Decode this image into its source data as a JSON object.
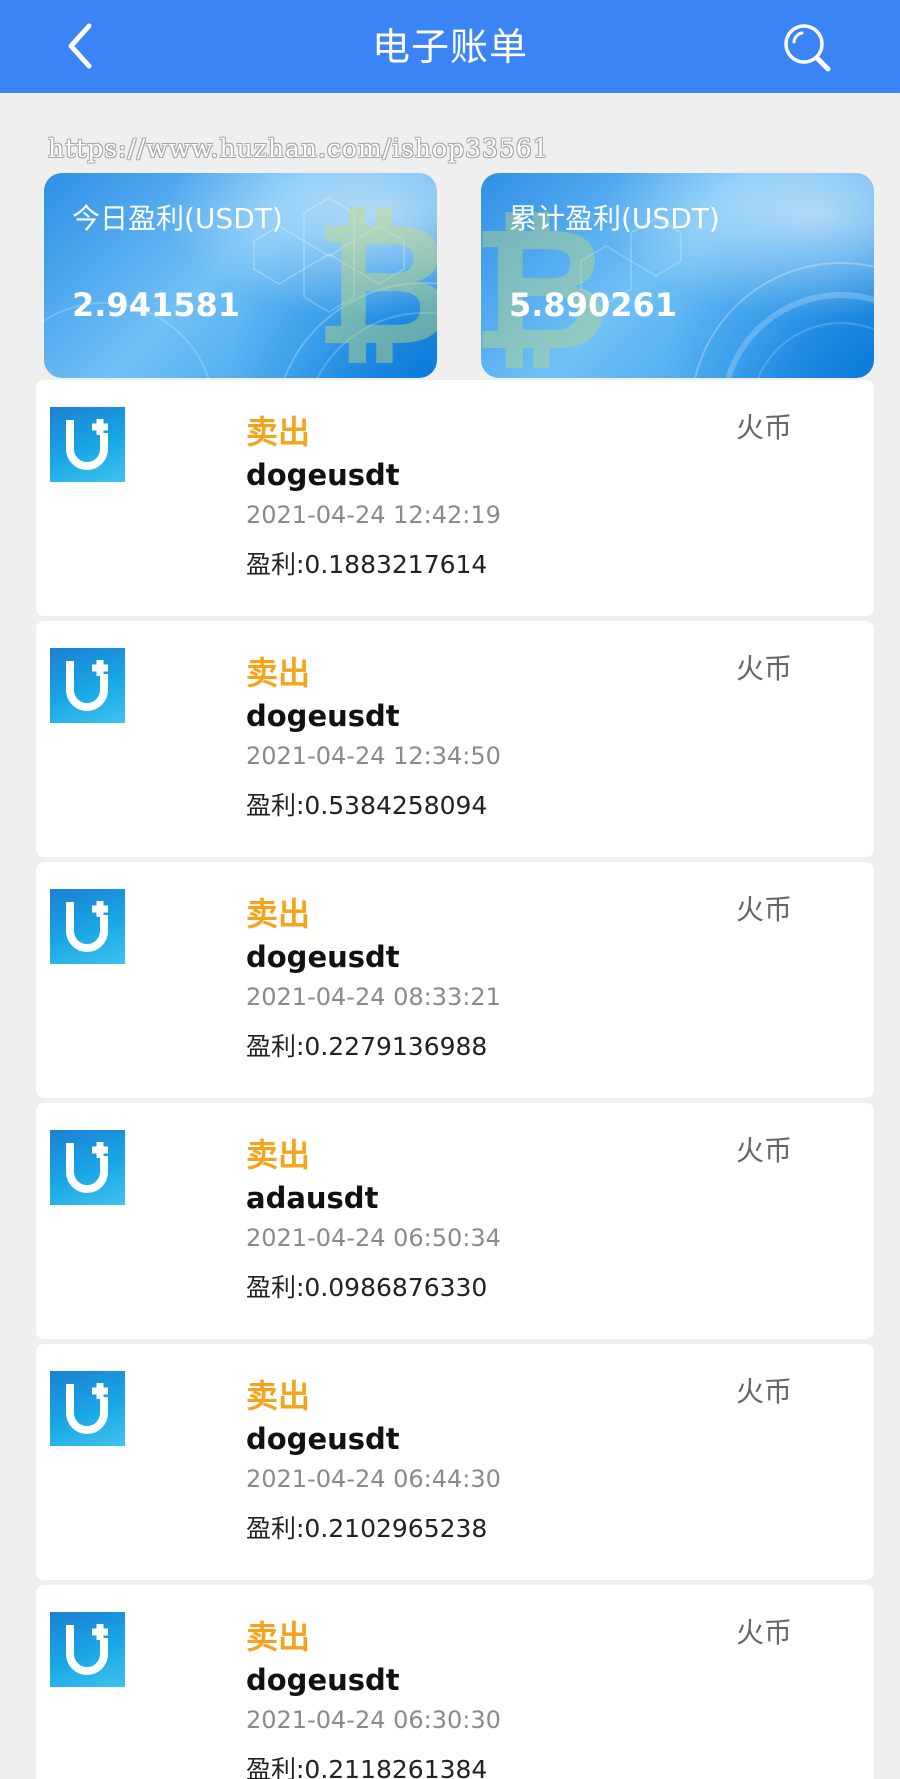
{
  "header": {
    "title": "电子账单",
    "back_icon": "chevron-left-icon",
    "search_icon": "search-icon",
    "background": "#3b84f5"
  },
  "watermark": "https://www.huzhan.com/ishop33561",
  "cards": [
    {
      "label": "今日盈利(USDT)",
      "value": "2.941581"
    },
    {
      "label": "累计盈利(USDT)",
      "value": "5.890261"
    }
  ],
  "transactions": [
    {
      "type": "卖出",
      "pair": "dogeusdt",
      "time": "2021-04-24 12:42:19",
      "profit": "盈利:0.1883217614",
      "exchange": "火币"
    },
    {
      "type": "卖出",
      "pair": "dogeusdt",
      "time": "2021-04-24 12:34:50",
      "profit": "盈利:0.5384258094",
      "exchange": "火币"
    },
    {
      "type": "卖出",
      "pair": "dogeusdt",
      "time": "2021-04-24 08:33:21",
      "profit": "盈利:0.2279136988",
      "exchange": "火币"
    },
    {
      "type": "卖出",
      "pair": "adausdt",
      "time": "2021-04-24 06:50:34",
      "profit": "盈利:0.0986876330",
      "exchange": "火币"
    },
    {
      "type": "卖出",
      "pair": "dogeusdt",
      "time": "2021-04-24 06:44:30",
      "profit": "盈利:0.2102965238",
      "exchange": "火币"
    },
    {
      "type": "卖出",
      "pair": "dogeusdt",
      "time": "2021-04-24 06:30:30",
      "profit": "盈利:0.2118261384",
      "exchange": "火币"
    }
  ],
  "colors": {
    "accent_orange": "#f5a31a",
    "card_blue": "#4aa9ee"
  }
}
